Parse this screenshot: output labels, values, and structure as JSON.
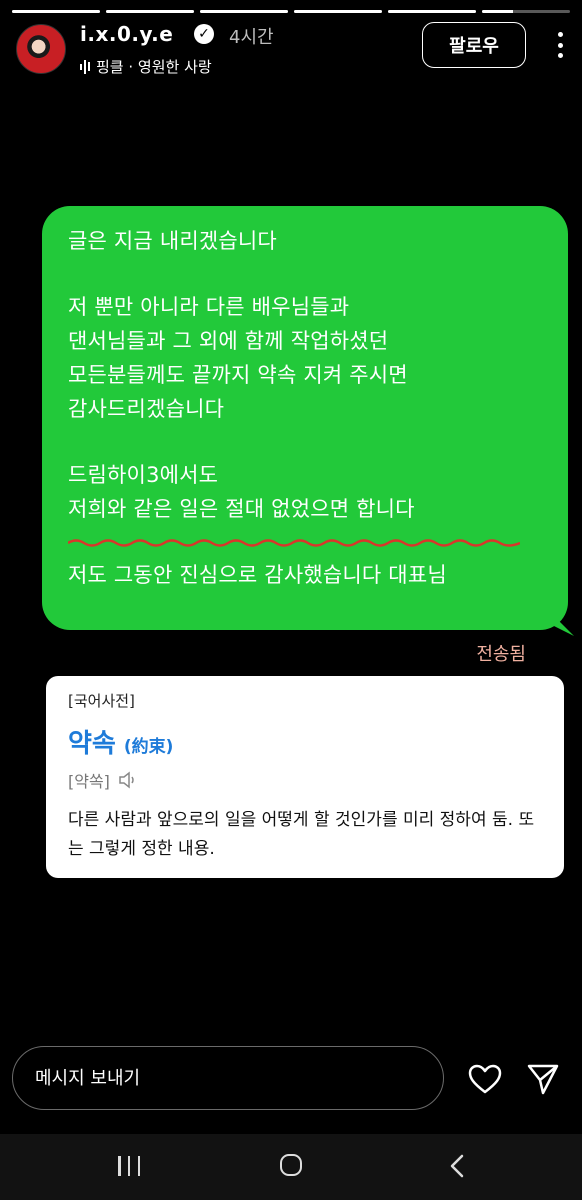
{
  "story": {
    "progress_segments": [
      1,
      1,
      1,
      1,
      1,
      0.35
    ],
    "username": "i.x.0.y.e",
    "time_ago": "4시간",
    "music_label": "핑클 · 영원한 사랑",
    "follow_label": "팔로우"
  },
  "message": {
    "lines": [
      "글은 지금 내리겠습니다",
      "",
      "저 뿐만 아니라 다른 배우님들과",
      "댄서님들과 그 외에 함께 작업하셨던",
      "모든분들께도 끝까지 약속 지켜 주시면",
      "감사드리겠습니다",
      "",
      "드림하이3에서도",
      "저희와 같은 일은 절대 없었으면 합니다",
      "",
      "저도 그동안 진심으로 감사했습니다 대표님"
    ],
    "status": "전송됨",
    "underline_color": "#d9362b"
  },
  "dictionary": {
    "label": "[국어사전]",
    "word": "약속",
    "hanja": "(約束)",
    "pronunciation": "[약쏙]",
    "definition": "다른 사람과 앞으로의 일을 어떻게 할 것인가를 미리 정하여 둠. 또는 그렇게 정한 내용."
  },
  "composer": {
    "placeholder": "메시지 보내기"
  },
  "colors": {
    "bubble": "#22c93a",
    "dict_word": "#1e7bd9"
  },
  "icons": {
    "verified": "verified-badge-icon",
    "music": "music-bars-icon",
    "more": "more-vertical-icon",
    "speaker": "speaker-icon",
    "heart": "heart-icon",
    "send": "send-icon",
    "recent": "recent-apps-icon",
    "home": "home-icon",
    "back": "back-icon"
  }
}
